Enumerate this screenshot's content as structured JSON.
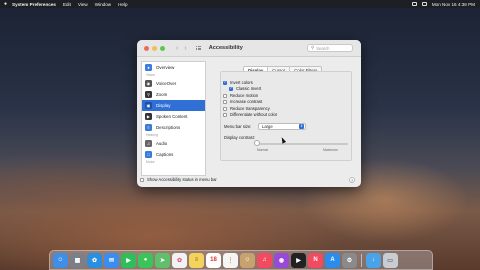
{
  "menubar": {
    "app_name": "System Preferences",
    "items": [
      "Edit",
      "View",
      "Window",
      "Help"
    ],
    "clock": "Mon Nov 16  4:36 PM"
  },
  "window": {
    "title": "Accessibility",
    "search_placeholder": "Search"
  },
  "sidebar": {
    "items": [
      {
        "label": "Overview",
        "icon": "overview-icon",
        "color": "#3b7ddd"
      },
      {
        "section": "Vision"
      },
      {
        "label": "VoiceOver",
        "icon": "voiceover-icon",
        "color": "#555555"
      },
      {
        "label": "Zoom",
        "icon": "zoom-icon",
        "color": "#333333"
      },
      {
        "label": "Display",
        "icon": "display-icon",
        "color": "#2a65c8",
        "selected": true
      },
      {
        "label": "Spoken Content",
        "icon": "spoken-content-icon",
        "color": "#333333"
      },
      {
        "label": "Descriptions",
        "icon": "descriptions-icon",
        "color": "#3a7bd5"
      },
      {
        "section": "Hearing"
      },
      {
        "label": "Audio",
        "icon": "audio-icon",
        "color": "#666666"
      },
      {
        "label": "Captions",
        "icon": "captions-icon",
        "color": "#3a7bd5"
      },
      {
        "section": "Motor"
      }
    ]
  },
  "tabs": [
    {
      "label": "Display",
      "selected": true
    },
    {
      "label": "Cursor"
    },
    {
      "label": "Color Filters"
    }
  ],
  "options": {
    "invert_colors": {
      "label": "Invert colors",
      "checked": true
    },
    "classic_invert": {
      "label": "Classic Invert",
      "checked": true
    },
    "reduce_motion": {
      "label": "Reduce motion",
      "checked": false
    },
    "increase_contrast": {
      "label": "Increase contrast",
      "checked": false
    },
    "reduce_transparency": {
      "label": "Reduce transparency",
      "checked": false
    },
    "differentiate": {
      "label": "Differentiate without color",
      "checked": false
    }
  },
  "menu_bar_size": {
    "label": "Menu bar size:",
    "value": "Large"
  },
  "display_contrast": {
    "label": "Display contrast:",
    "min_label": "Normal",
    "max_label": "Maximum",
    "level": 0.0
  },
  "footer": {
    "label": "Show Accessibility status in menu bar",
    "checked": false,
    "help": "?"
  },
  "dock": {
    "calendar_day": "18",
    "apps": [
      {
        "name": "finder-icon",
        "color": "#3d8fe8"
      },
      {
        "name": "launchpad-icon",
        "color": "#7a7f8a"
      },
      {
        "name": "safari-icon",
        "color": "#2a8fe0"
      },
      {
        "name": "mail-icon",
        "color": "#3a8ef0"
      },
      {
        "name": "facetime-icon",
        "color": "#2fbf5a"
      },
      {
        "name": "messages-icon",
        "color": "#3ac45a"
      },
      {
        "name": "maps-icon",
        "color": "#5fbf6a"
      },
      {
        "name": "photos-icon",
        "color": "#f2f2f2"
      },
      {
        "name": "notes-icon",
        "color": "#f3d35c"
      },
      {
        "name": "calendar-icon",
        "color": "#ffffff"
      },
      {
        "name": "reminders-icon",
        "color": "#f5f5f5"
      },
      {
        "name": "contacts-icon",
        "color": "#c8a26e"
      },
      {
        "name": "music-icon",
        "color": "#f24a5e"
      },
      {
        "name": "podcasts-icon",
        "color": "#9a48d8"
      },
      {
        "name": "tv-icon",
        "color": "#222222"
      },
      {
        "name": "news-icon",
        "color": "#f24a5e"
      },
      {
        "name": "app-store-icon",
        "color": "#2b8cf0"
      },
      {
        "name": "system-preferences-icon",
        "color": "#8a8a8a"
      },
      {
        "name": "downloads-folder-icon",
        "color": "#4aa3e8"
      },
      {
        "name": "trash-icon",
        "color": "#c9ccd2"
      }
    ]
  }
}
